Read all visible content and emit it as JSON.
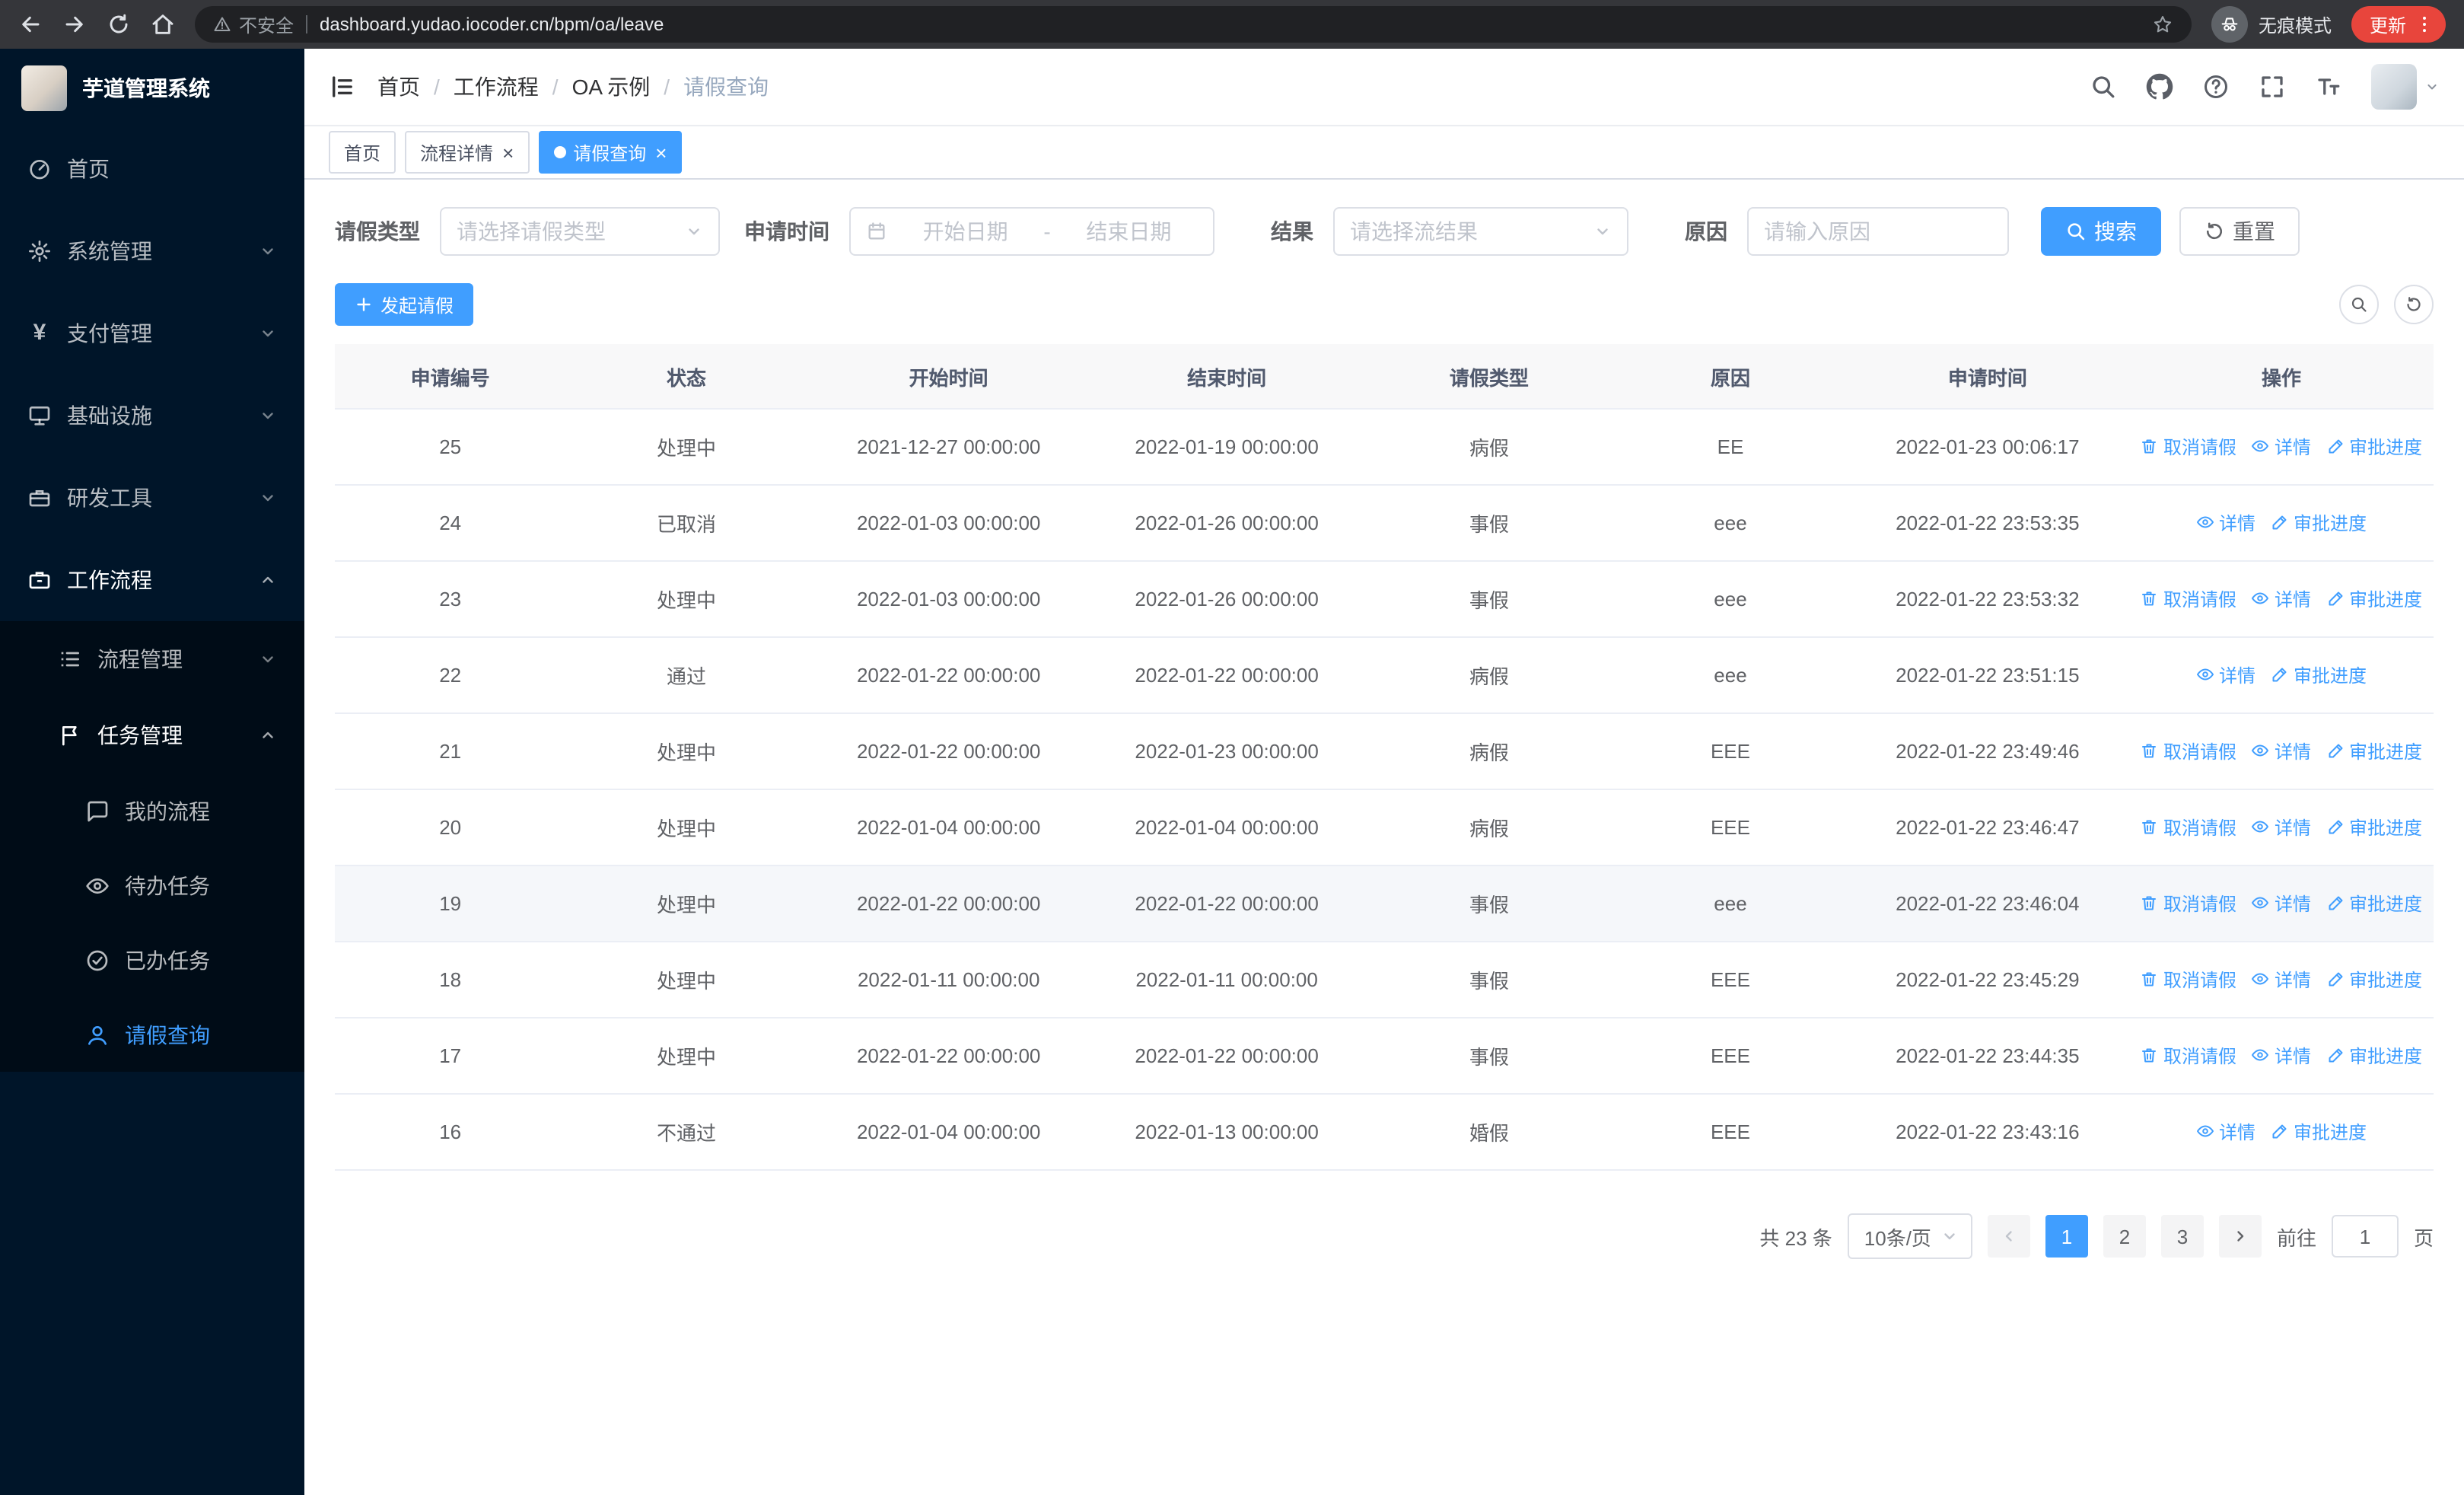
{
  "colors": {
    "primary": "#409eff",
    "sidebar_bg": "#001529",
    "sidebar_submenu_bg": "#000c17",
    "table_header_bg": "#f8f8f9",
    "update_chip_bg": "#e8453c"
  },
  "breadcrumb_sep": "/",
  "browser": {
    "security_label": "不安全",
    "url": "dashboard.yudao.iocoder.cn/bpm/oa/leave",
    "incognito_label": "无痕模式",
    "update_label": "更新"
  },
  "sidebar": {
    "app_title": "芋道管理系统",
    "yen_glyph": "¥",
    "items": [
      {
        "label": "首页",
        "icon": "dashboard-icon"
      },
      {
        "label": "系统管理",
        "icon": "gear-icon"
      },
      {
        "label": "支付管理",
        "icon": "yen-icon"
      },
      {
        "label": "基础设施",
        "icon": "monitor-icon"
      },
      {
        "label": "研发工具",
        "icon": "toolbox-icon"
      },
      {
        "label": "工作流程",
        "icon": "briefcase-icon"
      },
      {
        "label": "流程管理",
        "icon": "list-icon"
      },
      {
        "label": "任务管理",
        "icon": "flag-icon"
      },
      {
        "label": "我的流程",
        "icon": "chat-icon"
      },
      {
        "label": "待办任务",
        "icon": "eye-icon"
      },
      {
        "label": "已办任务",
        "icon": "check-circle-icon"
      },
      {
        "label": "请假查询",
        "icon": "user-icon"
      }
    ]
  },
  "breadcrumb": [
    "首页",
    "工作流程",
    "OA 示例",
    "请假查询"
  ],
  "tabs": [
    {
      "label": "首页",
      "closable": false,
      "active": false
    },
    {
      "label": "流程详情",
      "closable": true,
      "active": false
    },
    {
      "label": "请假查询",
      "closable": true,
      "active": true
    }
  ],
  "filters": {
    "leave_type_label": "请假类型",
    "leave_type_placeholder": "请选择请假类型",
    "apply_time_label": "申请时间",
    "start_date_placeholder": "开始日期",
    "range_separator": "-",
    "end_date_placeholder": "结束日期",
    "result_label": "结果",
    "result_placeholder": "请选择流结果",
    "reason_label": "原因",
    "reason_placeholder": "请输入原因",
    "search_button": "搜索",
    "reset_button": "重置"
  },
  "toolbar": {
    "create_button": "发起请假"
  },
  "table": {
    "headers": [
      "申请编号",
      "状态",
      "开始时间",
      "结束时间",
      "请假类型",
      "原因",
      "申请时间",
      "操作"
    ],
    "action_labels": {
      "cancel": "取消请假",
      "detail": "详情",
      "progress": "审批进度"
    },
    "rows": [
      {
        "id": "25",
        "status": "处理中",
        "start": "2021-12-27 00:00:00",
        "end": "2022-01-19 00:00:00",
        "type": "病假",
        "reason": "EE",
        "apply_time": "2022-01-23 00:06:17",
        "actions": [
          "cancel",
          "detail",
          "progress"
        ]
      },
      {
        "id": "24",
        "status": "已取消",
        "start": "2022-01-03 00:00:00",
        "end": "2022-01-26 00:00:00",
        "type": "事假",
        "reason": "eee",
        "apply_time": "2022-01-22 23:53:35",
        "actions": [
          "detail",
          "progress"
        ]
      },
      {
        "id": "23",
        "status": "处理中",
        "start": "2022-01-03 00:00:00",
        "end": "2022-01-26 00:00:00",
        "type": "事假",
        "reason": "eee",
        "apply_time": "2022-01-22 23:53:32",
        "actions": [
          "cancel",
          "detail",
          "progress"
        ]
      },
      {
        "id": "22",
        "status": "通过",
        "start": "2022-01-22 00:00:00",
        "end": "2022-01-22 00:00:00",
        "type": "病假",
        "reason": "eee",
        "apply_time": "2022-01-22 23:51:15",
        "actions": [
          "detail",
          "progress"
        ]
      },
      {
        "id": "21",
        "status": "处理中",
        "start": "2022-01-22 00:00:00",
        "end": "2022-01-23 00:00:00",
        "type": "病假",
        "reason": "EEE",
        "apply_time": "2022-01-22 23:49:46",
        "actions": [
          "cancel",
          "detail",
          "progress"
        ]
      },
      {
        "id": "20",
        "status": "处理中",
        "start": "2022-01-04 00:00:00",
        "end": "2022-01-04 00:00:00",
        "type": "病假",
        "reason": "EEE",
        "apply_time": "2022-01-22 23:46:47",
        "actions": [
          "cancel",
          "detail",
          "progress"
        ]
      },
      {
        "id": "19",
        "status": "处理中",
        "start": "2022-01-22 00:00:00",
        "end": "2022-01-22 00:00:00",
        "type": "事假",
        "reason": "eee",
        "apply_time": "2022-01-22 23:46:04",
        "actions": [
          "cancel",
          "detail",
          "progress"
        ],
        "highlighted": true
      },
      {
        "id": "18",
        "status": "处理中",
        "start": "2022-01-11 00:00:00",
        "end": "2022-01-11 00:00:00",
        "type": "事假",
        "reason": "EEE",
        "apply_time": "2022-01-22 23:45:29",
        "actions": [
          "cancel",
          "detail",
          "progress"
        ]
      },
      {
        "id": "17",
        "status": "处理中",
        "start": "2022-01-22 00:00:00",
        "end": "2022-01-22 00:00:00",
        "type": "事假",
        "reason": "EEE",
        "apply_time": "2022-01-22 23:44:35",
        "actions": [
          "cancel",
          "detail",
          "progress"
        ]
      },
      {
        "id": "16",
        "status": "不通过",
        "start": "2022-01-04 00:00:00",
        "end": "2022-01-13 00:00:00",
        "type": "婚假",
        "reason": "EEE",
        "apply_time": "2022-01-22 23:43:16",
        "actions": [
          "detail",
          "progress"
        ]
      }
    ]
  },
  "pagination": {
    "total": "共 23 条",
    "page_size": "10条/页",
    "pages": [
      "1",
      "2",
      "3"
    ],
    "active_page": "1",
    "goto_prefix": "前往",
    "goto_value": "1",
    "goto_suffix": "页"
  }
}
